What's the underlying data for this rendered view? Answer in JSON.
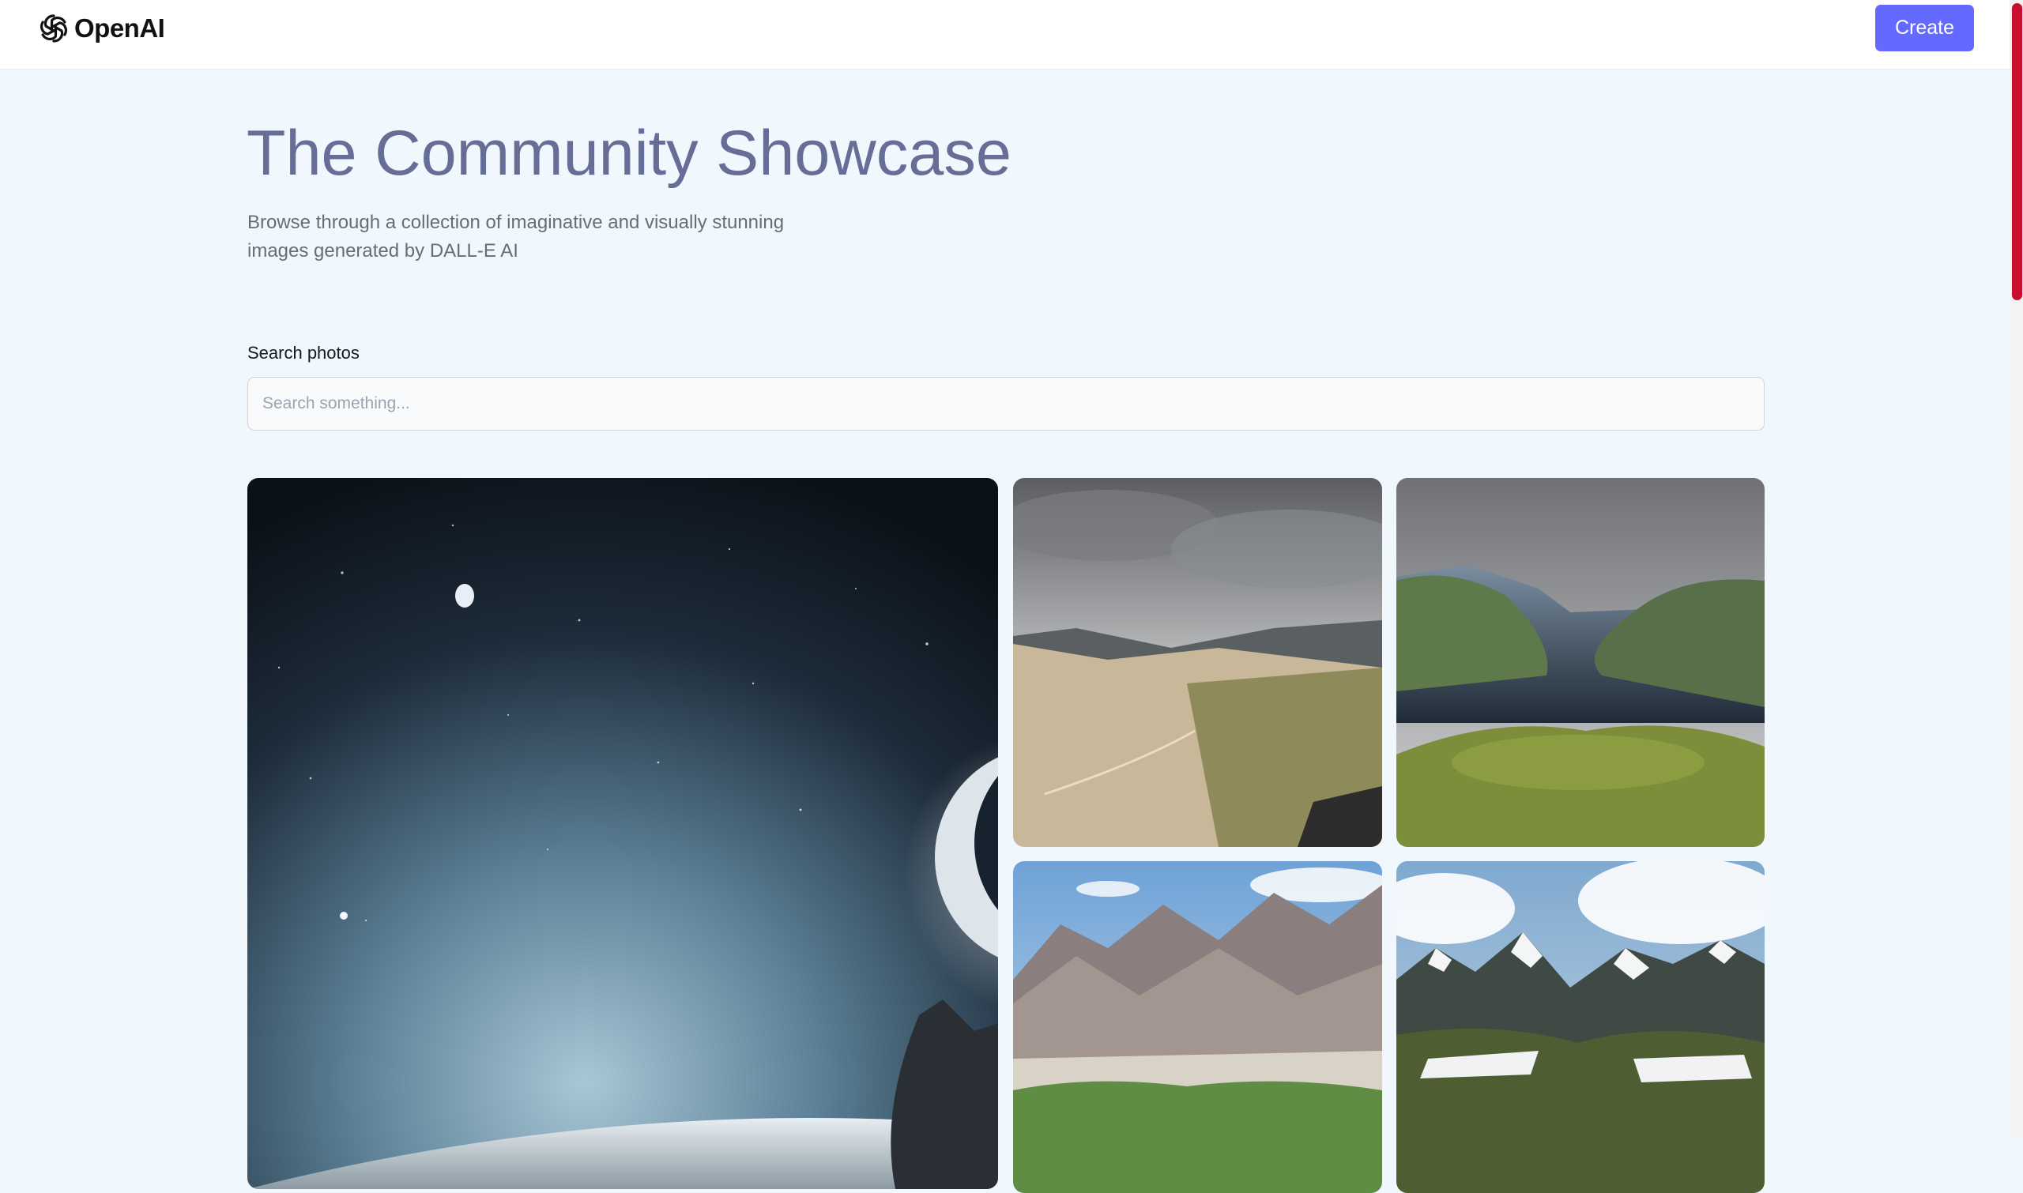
{
  "header": {
    "brand": "OpenAI",
    "create_label": "Create"
  },
  "hero": {
    "title": "The Community Showcase",
    "subtitle": "Browse through a collection of imaginative and visually stunning images generated by DALL-E AI"
  },
  "search": {
    "label": "Search photos",
    "value": "",
    "placeholder": "Search something..."
  },
  "gallery": {
    "cards": [
      {
        "subject": "crescent moon in starry space above a planet"
      },
      {
        "subject": "desert mountain valley under cloudy sky"
      },
      {
        "subject": "fjord with green cliffs and dark water"
      },
      {
        "subject": "barren mountains with green oasis"
      },
      {
        "subject": "snowy mountain range with meadow"
      }
    ]
  },
  "colors": {
    "accent": "#6469ff",
    "page_background": "#f0f7fd",
    "title": "#666e97",
    "scrollbar_thumb": "#c8102e"
  },
  "icons": {
    "logo": "openai-logo-icon"
  }
}
